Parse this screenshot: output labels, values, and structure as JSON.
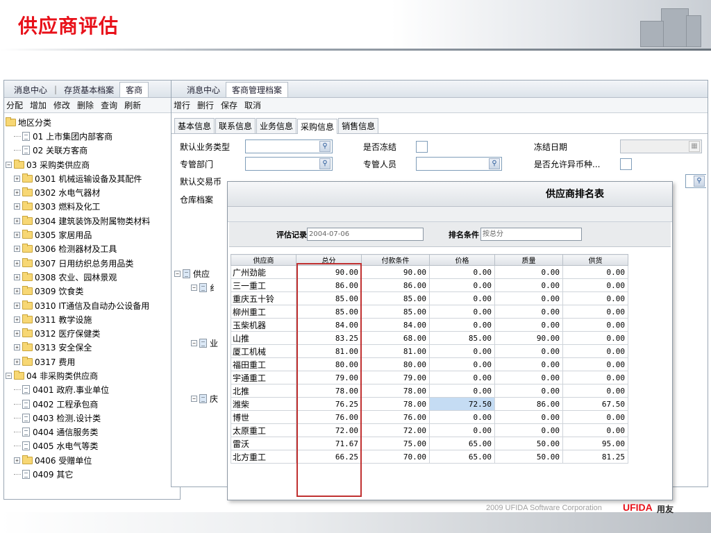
{
  "slide": {
    "title": "供应商评估",
    "footer_text": "2009 UFIDA Software Corporation",
    "brand": "UFIDA",
    "brand_cn": "用友"
  },
  "win1": {
    "tabs": [
      "消息中心",
      "存货基本档案",
      "客商"
    ],
    "toolbar": [
      "分配",
      "增加",
      "修改",
      "删除",
      "查询",
      "刷新"
    ],
    "tree": [
      {
        "level": 0,
        "type": "folder",
        "exp": "",
        "label": "地区分类"
      },
      {
        "level": 1,
        "type": "doc",
        "exp": "",
        "label": "01 上市集团内部客商"
      },
      {
        "level": 1,
        "type": "doc",
        "exp": "",
        "label": "02 关联方客商"
      },
      {
        "level": 0,
        "type": "folder",
        "exp": "−",
        "label": "03 采购类供应商"
      },
      {
        "level": 1,
        "type": "folder",
        "exp": "+",
        "label": "0301 机械运输设备及其配件"
      },
      {
        "level": 1,
        "type": "folder",
        "exp": "+",
        "label": "0302 水电气器材"
      },
      {
        "level": 1,
        "type": "folder",
        "exp": "+",
        "label": "0303 燃料及化工"
      },
      {
        "level": 1,
        "type": "folder",
        "exp": "+",
        "label": "0304 建筑装饰及附属物类材料"
      },
      {
        "level": 1,
        "type": "folder",
        "exp": "+",
        "label": "0305 家居用品"
      },
      {
        "level": 1,
        "type": "folder",
        "exp": "+",
        "label": "0306 检测器材及工具"
      },
      {
        "level": 1,
        "type": "folder",
        "exp": "+",
        "label": "0307 日用纺织总务用品类"
      },
      {
        "level": 1,
        "type": "folder",
        "exp": "+",
        "label": "0308 农业、园林景观"
      },
      {
        "level": 1,
        "type": "folder",
        "exp": "+",
        "label": "0309 饮食类"
      },
      {
        "level": 1,
        "type": "folder",
        "exp": "+",
        "label": "0310 IT通信及自动办公设备用"
      },
      {
        "level": 1,
        "type": "folder",
        "exp": "+",
        "label": "0311 教学设施"
      },
      {
        "level": 1,
        "type": "folder",
        "exp": "+",
        "label": "0312 医疗保健类"
      },
      {
        "level": 1,
        "type": "folder",
        "exp": "+",
        "label": "0313 安全保全"
      },
      {
        "level": 1,
        "type": "folder",
        "exp": "+",
        "label": "0317 费用"
      },
      {
        "level": 0,
        "type": "folder",
        "exp": "−",
        "label": "04 非采购类供应商"
      },
      {
        "level": 1,
        "type": "doc",
        "exp": "",
        "label": "0401 政府.事业单位"
      },
      {
        "level": 1,
        "type": "doc",
        "exp": "",
        "label": "0402 工程承包商"
      },
      {
        "level": 1,
        "type": "doc",
        "exp": "",
        "label": "0403 检测.设计类"
      },
      {
        "level": 1,
        "type": "doc",
        "exp": "",
        "label": "0404 通信服务类"
      },
      {
        "level": 1,
        "type": "doc",
        "exp": "",
        "label": "0405 水电气等类"
      },
      {
        "level": 1,
        "type": "folder",
        "exp": "+",
        "label": "0406 受赠单位"
      },
      {
        "level": 1,
        "type": "doc",
        "exp": "",
        "label": "0409 其它"
      }
    ]
  },
  "win2": {
    "tabs": [
      "消息中心",
      "客商管理档案"
    ],
    "toolbar": [
      "增行",
      "删行",
      "保存",
      "取消"
    ],
    "subtabs": [
      "基本信息",
      "联系信息",
      "业务信息",
      "采购信息",
      "销售信息"
    ],
    "labels": {
      "biz_type": "默认业务类型",
      "frozen": "是否冻结",
      "frozen_date": "冻结日期",
      "dept": "专管部门",
      "staff": "专管人员",
      "allow_currency": "是否允许异币种...",
      "currency": "默认交易币",
      "warehouse": "仓库档案"
    },
    "tree_labels": [
      "供应",
      "纟",
      "业",
      "庆"
    ]
  },
  "win3": {
    "title": "供应商排名表",
    "eval_label": "评估记录",
    "eval_value": "2004-07-06",
    "rank_label": "排名条件",
    "rank_value": "按总分",
    "columns": [
      "供应商",
      "总分",
      "付款条件",
      "价格",
      "质量",
      "供货"
    ],
    "rows": [
      [
        "广州劲能",
        "90.00",
        "90.00",
        "0.00",
        "0.00",
        "0.00"
      ],
      [
        "三一重工",
        "86.00",
        "86.00",
        "0.00",
        "0.00",
        "0.00"
      ],
      [
        "重庆五十铃",
        "85.00",
        "85.00",
        "0.00",
        "0.00",
        "0.00"
      ],
      [
        "柳州重工",
        "85.00",
        "85.00",
        "0.00",
        "0.00",
        "0.00"
      ],
      [
        "玉柴机器",
        "84.00",
        "84.00",
        "0.00",
        "0.00",
        "0.00"
      ],
      [
        "山推",
        "83.25",
        "68.00",
        "85.00",
        "90.00",
        "0.00"
      ],
      [
        "厦工机械",
        "81.00",
        "81.00",
        "0.00",
        "0.00",
        "0.00"
      ],
      [
        "福田重工",
        "80.00",
        "80.00",
        "0.00",
        "0.00",
        "0.00"
      ],
      [
        "宇通重工",
        "79.00",
        "79.00",
        "0.00",
        "0.00",
        "0.00"
      ],
      [
        "北推",
        "78.00",
        "78.00",
        "0.00",
        "0.00",
        "0.00"
      ],
      [
        "潍柴",
        "76.25",
        "78.00",
        "72.50",
        "86.00",
        "67.50"
      ],
      [
        "博世",
        "76.00",
        "76.00",
        "0.00",
        "0.00",
        "0.00"
      ],
      [
        "太原重工",
        "72.00",
        "72.00",
        "0.00",
        "0.00",
        "0.00"
      ],
      [
        "雷沃",
        "71.67",
        "75.00",
        "65.00",
        "50.00",
        "95.00"
      ],
      [
        "北方重工",
        "66.25",
        "70.00",
        "65.00",
        "50.00",
        "81.25"
      ]
    ]
  }
}
